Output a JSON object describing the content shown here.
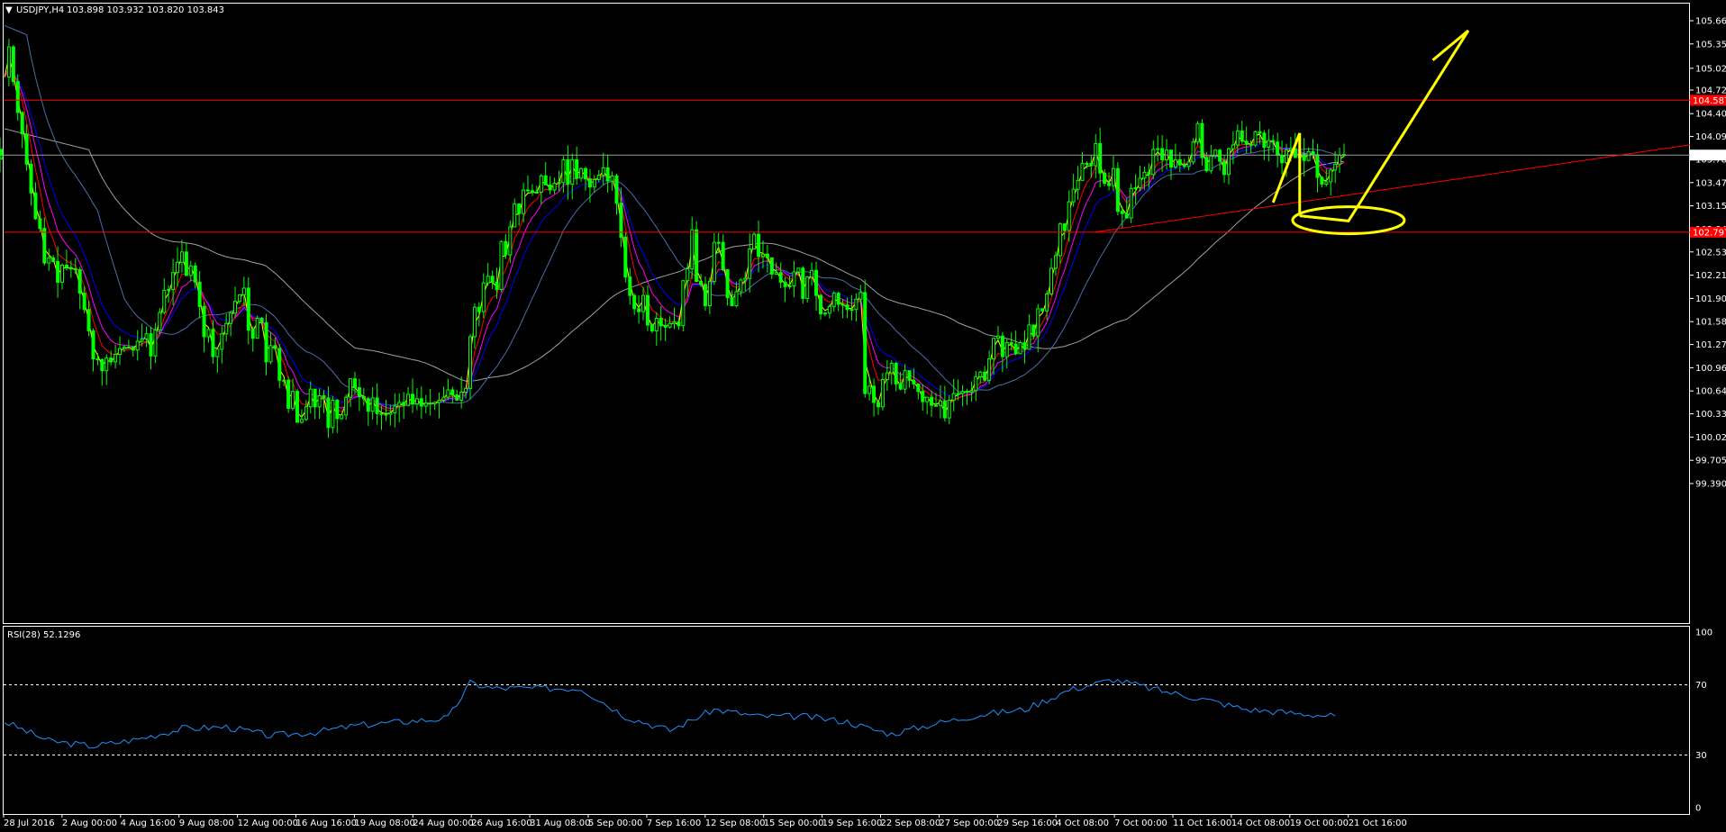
{
  "header": {
    "symbol": "USDJPY,H4",
    "ohlc": "103.898 103.932 103.820 103.843",
    "menu_glyph": "▼"
  },
  "colors": {
    "background": "#000000",
    "frame": "#ffffff",
    "candles": "#00ff00",
    "sr_lines": "#ff0000",
    "ema_fast": "#ffff00",
    "ema_mid": "#ff0000",
    "ema_slow": "#ff00ff",
    "ma_blue": "#0000ff",
    "ma_steel": "#4a6fa5",
    "ma_long": "#a0a0a0",
    "rsi_line": "#1e90ff",
    "annotation": "#ffff00",
    "current_price_tag": "#ffffff",
    "sr_tag": "#ff0000"
  },
  "chart_data": [
    {
      "type": "line",
      "title": "USDJPY,H4",
      "subtitle": "103.898 103.932 103.820 103.843",
      "x_tick_labels": [
        "28 Jul 2016",
        "2 Aug 00:00",
        "4 Aug 16:00",
        "9 Aug 08:00",
        "12 Aug 00:00",
        "16 Aug 16:00",
        "19 Aug 08:00",
        "24 Aug 00:00",
        "26 Aug 16:00",
        "31 Aug 08:00",
        "5 Sep 00:00",
        "7 Sep 16:00",
        "12 Sep 08:00",
        "15 Sep 00:00",
        "19 Sep 16:00",
        "22 Sep 08:00",
        "27 Sep 00:00",
        "29 Sep 16:00",
        "4 Oct 08:00",
        "7 Oct 00:00",
        "11 Oct 16:00",
        "14 Oct 08:00",
        "19 Oct 00:00",
        "21 Oct 16:00"
      ],
      "y_tick_labels": [
        "105.665",
        "105.350",
        "105.020",
        "104.725",
        "104.405",
        "104.095",
        "103.785",
        "103.470",
        "103.155",
        "102.840",
        "102.530",
        "102.215",
        "101.900",
        "101.585",
        "101.275",
        "100.960",
        "100.645",
        "100.335",
        "100.020",
        "99.705",
        "99.390"
      ],
      "ylim": [
        99.39,
        105.8
      ],
      "current_price": 103.843,
      "current_price_label": "103.843",
      "resistance": 104.587,
      "resistance_label": "104.587",
      "support": 102.797,
      "support_label": "102.797",
      "price_path_x": [
        0,
        1,
        2,
        3,
        4,
        5,
        6,
        7,
        8,
        9,
        10,
        11,
        12,
        13,
        14,
        15,
        16,
        17,
        18,
        19,
        20,
        21,
        22,
        23,
        24,
        25,
        26,
        27,
        28,
        29,
        30,
        31,
        32,
        33,
        34,
        35,
        36,
        37,
        38,
        39,
        40,
        41,
        42,
        43,
        44,
        45,
        46,
        47,
        48,
        49,
        50,
        51,
        52,
        53,
        54,
        55,
        56,
        57,
        58,
        59,
        60,
        61,
        62,
        63,
        64,
        65,
        66,
        67,
        68,
        69,
        70,
        71,
        72,
        73,
        74,
        75,
        76,
        77,
        78,
        79,
        80,
        81,
        82,
        83,
        84,
        85,
        86,
        87,
        88,
        89,
        90,
        91,
        92,
        93,
        94,
        95,
        96,
        97,
        98,
        99,
        100,
        101,
        102,
        103,
        104,
        105,
        106,
        107,
        108,
        109,
        110,
        111,
        112,
        113,
        114,
        115,
        116,
        117,
        118,
        119,
        120,
        121,
        122,
        123,
        124,
        125,
        126,
        127,
        128,
        129,
        130,
        131,
        132,
        133,
        134,
        135,
        136,
        137,
        138,
        139,
        140,
        141,
        142,
        143,
        144,
        145,
        146,
        147,
        148,
        149,
        150,
        151,
        152,
        153,
        154,
        155,
        156,
        157,
        158,
        159,
        160,
        161,
        162,
        163,
        164,
        165,
        166,
        167,
        168,
        169,
        170,
        171,
        172,
        173,
        174,
        175,
        176,
        177,
        178,
        179,
        180,
        181,
        182,
        183,
        184,
        185,
        186,
        187,
        188,
        189,
        190,
        191,
        192,
        193,
        194,
        195,
        196,
        197,
        198,
        199,
        200,
        201,
        202,
        203,
        204,
        205,
        206,
        207,
        208,
        209,
        210,
        211,
        212,
        213,
        214,
        215,
        216,
        217,
        218,
        219,
        220,
        221,
        222,
        223,
        224,
        225,
        226,
        227,
        228,
        229,
        230,
        231,
        232,
        233,
        234,
        235,
        236,
        237,
        238,
        239,
        240,
        241,
        242,
        243,
        244,
        245,
        246,
        247,
        248,
        249,
        250,
        251,
        252,
        253,
        254,
        255,
        256,
        257,
        258,
        259,
        260,
        261,
        262,
        263,
        264,
        265,
        266,
        267,
        268,
        269,
        270,
        271,
        272,
        273,
        274,
        275,
        276,
        277,
        278,
        279,
        280,
        281,
        282,
        283,
        284,
        285,
        286,
        287,
        288,
        289,
        290,
        291,
        292,
        293,
        294,
        295,
        296,
        297,
        298,
        299,
        300,
        301,
        302
      ],
      "price_path_y": [
        104.9,
        105.31,
        104.84,
        104.42,
        104.13,
        103.72,
        103.33,
        102.98,
        102.85,
        102.38,
        102.45,
        102.4,
        102.12,
        102.35,
        102.32,
        102.3,
        102.29,
        101.97,
        101.75,
        101.46,
        101.08,
        101.07,
        100.92,
        101.09,
        101.04,
        101.14,
        101.22,
        101.24,
        101.24,
        101.2,
        101.32,
        101.35,
        101.42,
        101.12,
        101.47,
        101.71,
        102.01,
        102.02,
        102.25,
        102.39,
        102.53,
        102.21,
        102.34,
        102.12,
        101.79,
        101.38,
        101.48,
        101.11,
        101.21,
        101.42,
        101.56,
        101.7,
        101.86,
        101.95,
        102.04,
        101.47,
        101.36,
        101.63,
        101.57,
        101.04,
        101.26,
        101.22,
        100.79,
        100.79,
        100.41,
        100.64,
        100.22,
        100.26,
        100.43,
        100.67,
        100.43,
        100.58,
        100.55,
        100.15,
        100.52,
        100.27,
        100.32,
        100.56,
        100.81,
        100.69,
        100.57,
        100.54,
        100.37,
        100.55,
        100.34,
        100.33,
        100.33,
        100.35,
        100.44,
        100.49,
        100.45,
        100.6,
        100.47,
        100.54,
        100.44,
        100.48,
        100.47,
        100.49,
        100.52,
        100.56,
        100.66,
        100.59,
        100.52,
        100.63,
        100.68,
        101.38,
        101.78,
        101.72,
        102.11,
        102.2,
        102.12,
        102.02,
        102.67,
        102.49,
        102.87,
        103.18,
        103.05,
        103.37,
        103.36,
        103.34,
        103.34,
        103.56,
        103.44,
        103.37,
        103.46,
        103.47,
        103.78,
        103.45,
        103.78,
        103.53,
        103.66,
        103.52,
        103.41,
        103.51,
        103.57,
        103.67,
        103.49,
        103.56,
        103.19,
        102.73,
        102.19,
        101.94,
        101.76,
        101.72,
        101.94,
        101.54,
        101.46,
        101.63,
        101.53,
        101.51,
        101.56,
        101.58,
        101.53,
        102.14,
        102.3,
        102.83,
        102.13,
        102.09,
        101.8,
        102.13,
        102.66,
        102.66,
        102.29,
        101.91,
        101.8,
        101.99,
        102.15,
        102.17,
        102.57,
        102.77,
        102.47,
        102.5,
        102.45,
        102.23,
        102.25,
        102.12,
        102.06,
        102.07,
        102.26,
        102.31,
        101.9,
        102.19,
        102.28,
        101.94,
        101.69,
        101.7,
        101.79,
        101.97,
        101.82,
        101.81,
        101.75,
        101.75,
        101.89,
        101.98,
        100.61,
        100.71,
        100.49,
        100.43,
        100.8,
        100.89,
        101.02,
        100.74,
        100.67,
        100.92,
        100.79,
        100.74,
        100.64,
        100.5,
        100.56,
        100.45,
        100.45,
        100.51,
        100.28,
        100.52,
        100.61,
        100.61,
        100.64,
        100.63,
        100.65,
        100.84,
        100.9,
        100.79,
        101.08,
        101.36,
        101.39,
        101.11,
        101.3,
        101.28,
        101.15,
        101.3,
        101.21,
        101.54,
        101.39,
        101.76,
        101.73,
        101.96,
        102.31,
        102.48,
        102.91,
        102.82,
        103.21,
        103.38,
        103.5,
        103.73,
        103.73,
        103.7,
        104.0,
        103.6,
        103.46,
        103.43,
        103.66,
        103.08,
        103.05,
        102.99,
        103.39,
        103.4,
        103.53,
        103.61,
        103.58,
        103.92,
        103.93,
        103.78,
        103.91,
        103.68,
        103.78,
        103.71,
        103.69,
        103.75,
        104.02,
        104.27,
        103.81,
        103.63,
        103.83,
        103.91,
        103.76,
        103.58,
        103.93,
        103.98,
        104.17,
        104.03,
        103.99,
        103.98,
        104.16,
        104.14,
        103.95,
        104.04,
        104.02,
        103.84,
        103.74,
        103.91,
        103.93,
        103.81,
        103.86,
        103.77,
        103.89,
        103.85,
        103.54,
        103.45,
        103.48,
        103.64,
        103.72,
        103.84,
        103.85,
        103.92,
        103.79,
        103.81,
        103.84
      ],
      "trendline": {
        "from": [
          246,
          102.8
        ],
        "to": [
          390,
          104.07
        ]
      },
      "projection": {
        "x": [
          292,
          303,
          330,
          322
        ],
        "y": [
          103.02,
          102.95,
          105.53,
          105.13
        ]
      },
      "target_ellipse_center": [
        303,
        102.96
      ]
    },
    {
      "type": "line",
      "title": "RSI(28) 52.1296",
      "y_tick_labels": [
        "100",
        "70",
        "30",
        "0"
      ],
      "ylim": [
        0,
        100
      ],
      "levels": [
        70,
        30
      ],
      "series": [
        {
          "name": "RSI(28)",
          "x": [
            0,
            10,
            20,
            30,
            40,
            50,
            60,
            70,
            80,
            90,
            100,
            105,
            110,
            120,
            130,
            140,
            150,
            160,
            170,
            180,
            190,
            195,
            200,
            210,
            220,
            230,
            240,
            250,
            260,
            270,
            280,
            290,
            300
          ],
          "values": [
            49,
            38,
            35,
            39,
            45,
            46,
            41,
            43,
            47,
            49,
            51,
            71,
            68,
            68,
            68,
            52,
            44,
            56,
            52,
            52,
            49,
            45,
            42,
            48,
            53,
            56,
            67,
            73,
            67,
            62,
            56,
            54,
            52.13
          ]
        }
      ]
    }
  ]
}
